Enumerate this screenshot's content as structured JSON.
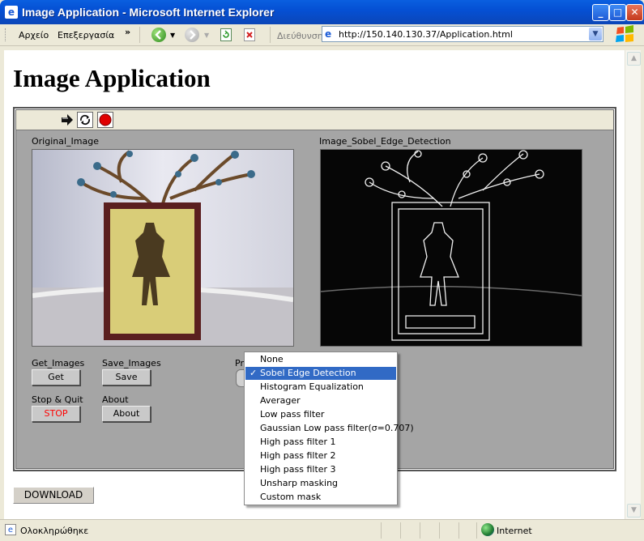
{
  "window": {
    "title": "Image Application - Microsoft Internet Explorer"
  },
  "menu": {
    "file": "Αρχείο",
    "edit": "Επεξεργασία",
    "more": "»"
  },
  "addressbar": {
    "label": "Διεύθυνση",
    "url": "http://150.140.130.37/Application.html"
  },
  "page": {
    "heading": "Image Application"
  },
  "vi": {
    "original_label": "Original_Image",
    "processed_label": "Image_Sobel_Edge_Detection",
    "get_images_label": "Get_Images",
    "get_button": "Get",
    "save_images_label": "Save_Images",
    "save_button": "Save",
    "stop_quit_label": "Stop & Quit",
    "stop_button": "STOP",
    "about_label": "About",
    "about_button": "About",
    "processing_label_partial": "Pr"
  },
  "dropdown": {
    "selected_index": 1,
    "options": [
      "None",
      "Sobel Edge Detection",
      "Histogram Equalization",
      "Averager",
      "Low pass filter",
      "Gaussian Low pass filter(σ=0.707)",
      "High pass filter 1",
      "High pass filter 2",
      "High pass filter 3",
      "Unsharp masking",
      "Custom mask"
    ],
    "check_glyph": "✓"
  },
  "download_button": "DOWNLOAD",
  "statusbar": {
    "text": "Ολοκληρώθηκε",
    "zone": "Internet"
  },
  "colors": {
    "titlebar": "#0550d4",
    "selection": "#316ac5",
    "stop_text": "#ff0000",
    "vi_panel": "#a5a5a5"
  }
}
